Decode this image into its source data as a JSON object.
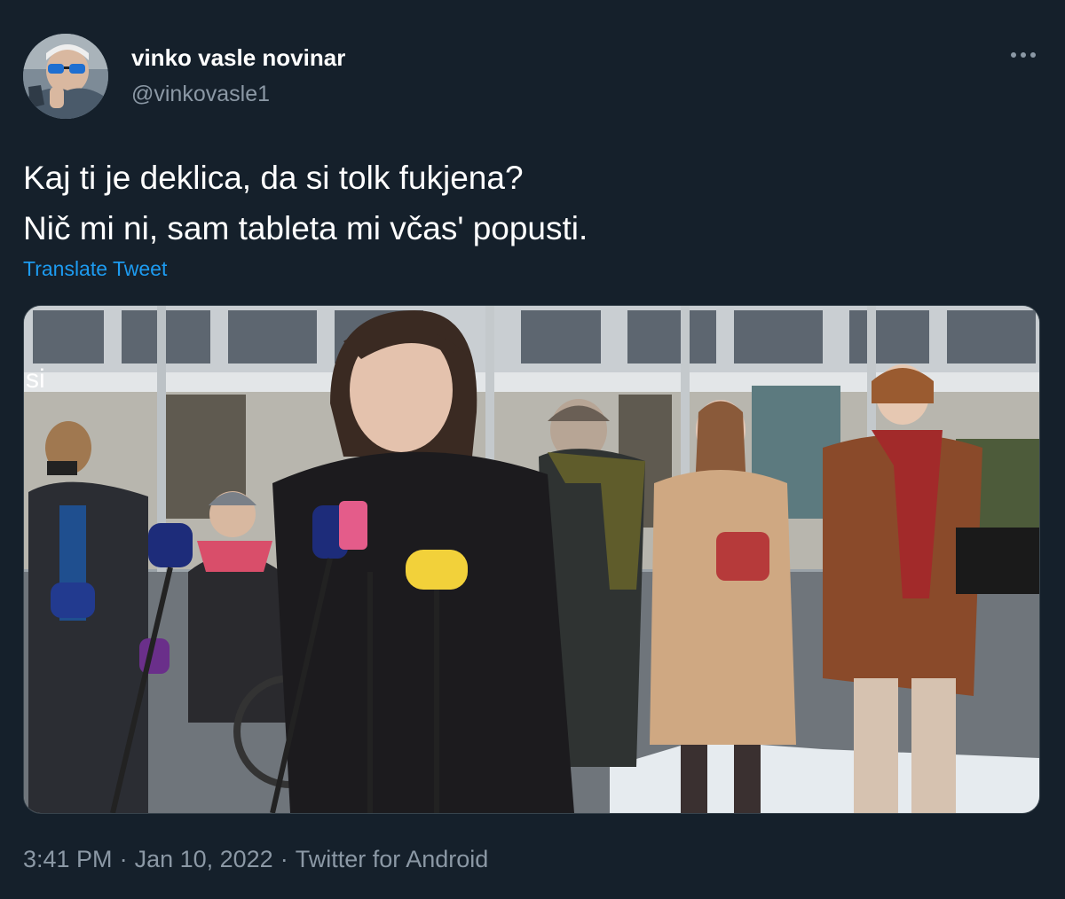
{
  "author": {
    "display_name": "vinko vasle novinar",
    "handle": "@vinkovasle1",
    "avatar_icon": "profile-photo-avatar"
  },
  "more_icon": "ellipsis-icon",
  "tweet": {
    "lines": [
      "Kaj ti je deklica, da si tolk fukjena?",
      "Nič mi ni, sam tableta mi včas' popusti."
    ],
    "translate_label": "Translate Tweet"
  },
  "media": {
    "type": "video-still",
    "description_icon": "press-conference-photo",
    "building_sign": "si"
  },
  "meta": {
    "time": "3:41 PM",
    "separator": "·",
    "date": "Jan 10, 2022",
    "source": "Twitter for Android"
  },
  "colors": {
    "background": "#15202b",
    "text_primary": "#ffffff",
    "text_secondary": "#8b98a5",
    "link": "#1d9bf0"
  }
}
